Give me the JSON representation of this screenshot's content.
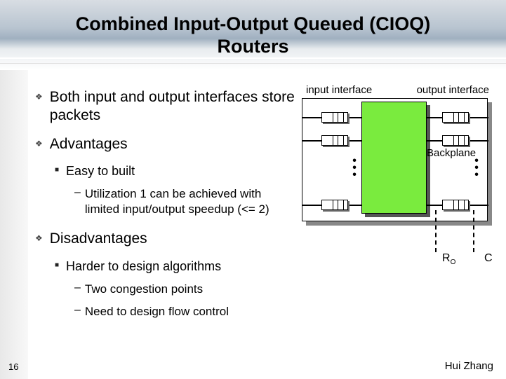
{
  "title_line1": "Combined Input-Output Queued (CIOQ)",
  "title_line2": "Routers",
  "bullets": {
    "b1": "Both input and output interfaces store packets",
    "b2": "Advantages",
    "b2_1": "Easy to built",
    "b2_1_1": "Utilization 1 can be achieved with limited input/output speedup (<= 2)",
    "b3": "Disadvantages",
    "b3_1": "Harder to design algorithms",
    "b3_1_1": "Two congestion points",
    "b3_1_2": "Need to design flow control"
  },
  "diagram": {
    "input_label": "input interface",
    "output_label": "output interface",
    "backplane_label": "Backplane",
    "ro_label": "R",
    "ro_sub": "O",
    "c_label": "C"
  },
  "page_number": "16",
  "author": "Hui Zhang"
}
